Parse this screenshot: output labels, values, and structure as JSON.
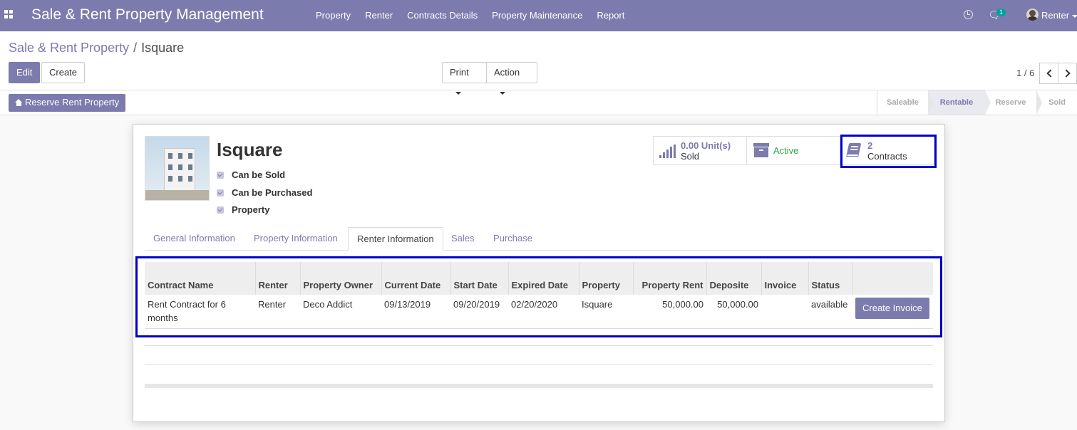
{
  "navbar": {
    "app_title": "Sale & Rent Property Management",
    "menu": [
      "Property",
      "Renter",
      "Contracts Details",
      "Property Maintenance",
      "Report"
    ],
    "chat_count": "1",
    "user_name": "Renter"
  },
  "breadcrumb": {
    "parent": "Sale & Rent Property",
    "current": "Isquare"
  },
  "toolbar": {
    "edit_label": "Edit",
    "create_label": "Create",
    "print_label": "Print",
    "action_label": "Action",
    "pager_value": "1 / 6"
  },
  "header": {
    "reserve_button": "Reserve Rent Property",
    "stages": [
      "Saleable",
      "Rentable",
      "Reserve",
      "Sold"
    ],
    "active_stage": "Rentable"
  },
  "record": {
    "name": "Isquare",
    "checkboxes": [
      "Can be Sold",
      "Can be Purchased",
      "Property"
    ]
  },
  "smart_buttons": {
    "sold": {
      "value": "0.00 Unit(s)",
      "label": "Sold"
    },
    "active_label": "Active",
    "contracts": {
      "value": "2",
      "label": "Contracts"
    }
  },
  "tabs": [
    "General Information",
    "Property Information",
    "Renter Information",
    "Sales",
    "Purchase"
  ],
  "active_tab": "Renter Information",
  "contracts_table": {
    "headers": [
      "Contract Name",
      "Renter",
      "Property Owner",
      "Current Date",
      "Start Date",
      "Expired Date",
      "Property",
      "Property Rent",
      "Deposite",
      "Invoice",
      "Status",
      ""
    ],
    "rows": [
      {
        "contract_name": "Rent Contract for 6 months",
        "renter": "Renter",
        "owner": "Deco Addict",
        "current_date": "09/13/2019",
        "start_date": "09/20/2019",
        "expired_date": "02/20/2020",
        "property": "Isquare",
        "rent": "50,000.00",
        "deposit": "50,000.00",
        "invoice": "",
        "status": "available",
        "action_label": "Create Invoice"
      }
    ]
  },
  "colors": {
    "brand": "#7c7bad",
    "highlight": "#0000cc",
    "active_green": "#28a745"
  }
}
